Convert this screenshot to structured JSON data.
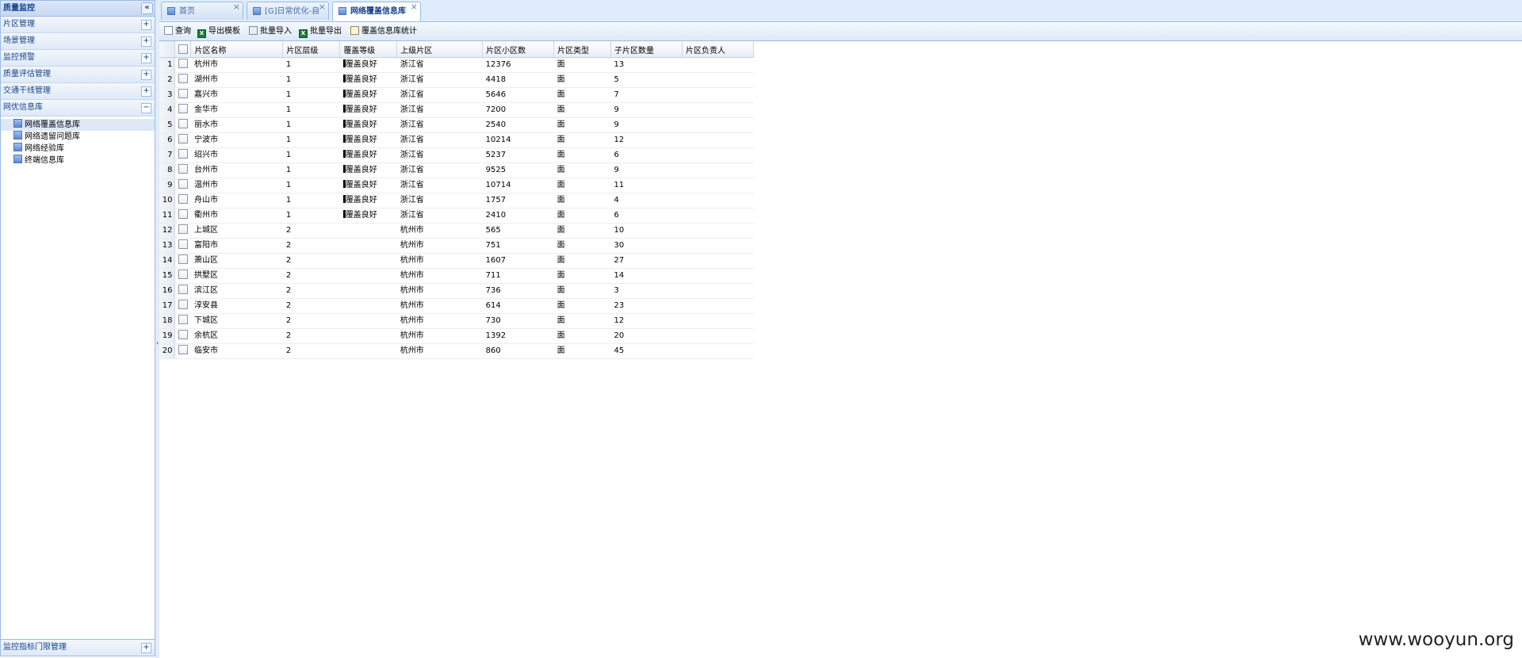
{
  "sidebar": {
    "title": "质量监控",
    "collapse_glyph": "«",
    "sections": [
      {
        "label": "片区管理",
        "toggle": "+"
      },
      {
        "label": "场景管理",
        "toggle": "+"
      },
      {
        "label": "监控预警",
        "toggle": "+"
      },
      {
        "label": "质量评估管理",
        "toggle": "+"
      },
      {
        "label": "交通干线管理",
        "toggle": "+"
      },
      {
        "label": "网优信息库",
        "toggle": "−"
      }
    ],
    "tree": [
      {
        "label": "网络覆盖信息库"
      },
      {
        "label": "网络遗留问题库"
      },
      {
        "label": "网络经验库"
      },
      {
        "label": "终端信息库"
      }
    ],
    "bottom": {
      "label": "监控指标门限管理",
      "toggle": "+"
    }
  },
  "tabs": [
    {
      "label": "首页",
      "close": "×"
    },
    {
      "label": "[G]日常优化-自",
      "close": "×"
    },
    {
      "label": "网络覆盖信息库",
      "close": "×"
    }
  ],
  "toolbar": {
    "query": "查询",
    "export_template": "导出模板",
    "batch_import": "批量导入",
    "batch_export": "批量导出",
    "coverage_stats": "覆盖信息库统计"
  },
  "grid": {
    "columns": [
      "片区名称",
      "片区层级",
      "覆盖等级",
      "上级片区",
      "片区小区数",
      "片区类型",
      "子片区数量",
      "片区负责人"
    ],
    "rows": [
      {
        "n": "1",
        "name": "杭州市",
        "level": "1",
        "cov": "覆盖良好",
        "parent": "浙江省",
        "cells": "12376",
        "type": "面",
        "sub": "13",
        "owner": ""
      },
      {
        "n": "2",
        "name": "湖州市",
        "level": "1",
        "cov": "覆盖良好",
        "parent": "浙江省",
        "cells": "4418",
        "type": "面",
        "sub": "5",
        "owner": ""
      },
      {
        "n": "3",
        "name": "嘉兴市",
        "level": "1",
        "cov": "覆盖良好",
        "parent": "浙江省",
        "cells": "5646",
        "type": "面",
        "sub": "7",
        "owner": ""
      },
      {
        "n": "4",
        "name": "金华市",
        "level": "1",
        "cov": "覆盖良好",
        "parent": "浙江省",
        "cells": "7200",
        "type": "面",
        "sub": "9",
        "owner": ""
      },
      {
        "n": "5",
        "name": "丽水市",
        "level": "1",
        "cov": "覆盖良好",
        "parent": "浙江省",
        "cells": "2540",
        "type": "面",
        "sub": "9",
        "owner": ""
      },
      {
        "n": "6",
        "name": "宁波市",
        "level": "1",
        "cov": "覆盖良好",
        "parent": "浙江省",
        "cells": "10214",
        "type": "面",
        "sub": "12",
        "owner": ""
      },
      {
        "n": "7",
        "name": "绍兴市",
        "level": "1",
        "cov": "覆盖良好",
        "parent": "浙江省",
        "cells": "5237",
        "type": "面",
        "sub": "6",
        "owner": ""
      },
      {
        "n": "8",
        "name": "台州市",
        "level": "1",
        "cov": "覆盖良好",
        "parent": "浙江省",
        "cells": "9525",
        "type": "面",
        "sub": "9",
        "owner": ""
      },
      {
        "n": "9",
        "name": "温州市",
        "level": "1",
        "cov": "覆盖良好",
        "parent": "浙江省",
        "cells": "10714",
        "type": "面",
        "sub": "11",
        "owner": ""
      },
      {
        "n": "10",
        "name": "舟山市",
        "level": "1",
        "cov": "覆盖良好",
        "parent": "浙江省",
        "cells": "1757",
        "type": "面",
        "sub": "4",
        "owner": ""
      },
      {
        "n": "11",
        "name": "衢州市",
        "level": "1",
        "cov": "覆盖良好",
        "parent": "浙江省",
        "cells": "2410",
        "type": "面",
        "sub": "6",
        "owner": ""
      },
      {
        "n": "12",
        "name": "上城区",
        "level": "2",
        "cov": "",
        "parent": "杭州市",
        "cells": "565",
        "type": "面",
        "sub": "10",
        "owner": ""
      },
      {
        "n": "13",
        "name": "富阳市",
        "level": "2",
        "cov": "",
        "parent": "杭州市",
        "cells": "751",
        "type": "面",
        "sub": "30",
        "owner": ""
      },
      {
        "n": "14",
        "name": "萧山区",
        "level": "2",
        "cov": "",
        "parent": "杭州市",
        "cells": "1607",
        "type": "面",
        "sub": "27",
        "owner": ""
      },
      {
        "n": "15",
        "name": "拱墅区",
        "level": "2",
        "cov": "",
        "parent": "杭州市",
        "cells": "711",
        "type": "面",
        "sub": "14",
        "owner": ""
      },
      {
        "n": "16",
        "name": "滨江区",
        "level": "2",
        "cov": "",
        "parent": "杭州市",
        "cells": "736",
        "type": "面",
        "sub": "3",
        "owner": ""
      },
      {
        "n": "17",
        "name": "淳安县",
        "level": "2",
        "cov": "",
        "parent": "杭州市",
        "cells": "614",
        "type": "面",
        "sub": "23",
        "owner": ""
      },
      {
        "n": "18",
        "name": "下城区",
        "level": "2",
        "cov": "",
        "parent": "杭州市",
        "cells": "730",
        "type": "面",
        "sub": "12",
        "owner": ""
      },
      {
        "n": "19",
        "name": "余杭区",
        "level": "2",
        "cov": "",
        "parent": "杭州市",
        "cells": "1392",
        "type": "面",
        "sub": "20",
        "owner": ""
      },
      {
        "n": "20",
        "name": "临安市",
        "level": "2",
        "cov": "",
        "parent": "杭州市",
        "cells": "860",
        "type": "面",
        "sub": "45",
        "owner": ""
      }
    ]
  },
  "watermark": "www.wooyun.org"
}
